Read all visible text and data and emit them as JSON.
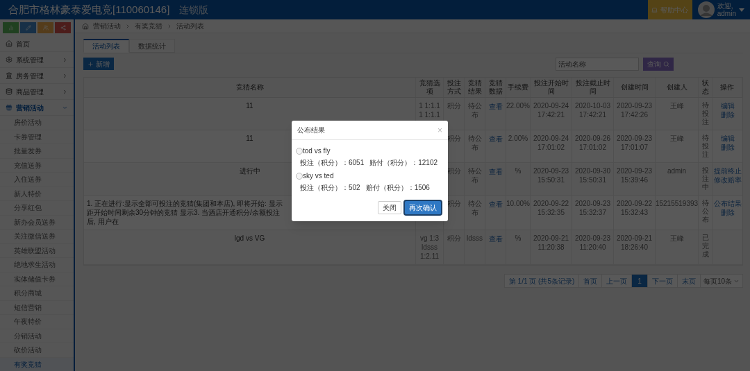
{
  "header": {
    "title": "合肥市格林豪泰爱电竞[110060146]",
    "edition": "连锁版",
    "help": "帮助中心",
    "greeting": "欢迎,",
    "user": "admin"
  },
  "sidebar": {
    "items": [
      {
        "label": "首页",
        "kind": "link"
      },
      {
        "label": "系统管理",
        "kind": "group",
        "expanded": false
      },
      {
        "label": "房务管理",
        "kind": "group",
        "expanded": false
      },
      {
        "label": "商品管理",
        "kind": "group",
        "expanded": false
      },
      {
        "label": "营销活动",
        "kind": "group",
        "expanded": true,
        "children": [
          {
            "label": "房价活动",
            "selected": false
          },
          {
            "label": "卡券管理",
            "selected": false
          },
          {
            "label": "批量发券",
            "selected": false
          },
          {
            "label": "充值送券",
            "selected": false
          },
          {
            "label": "入住送券",
            "selected": false
          },
          {
            "label": "新人特价",
            "selected": false
          },
          {
            "label": "分享红包",
            "selected": false
          },
          {
            "label": "新办会员送券",
            "selected": false
          },
          {
            "label": "关注微信送券",
            "selected": false
          },
          {
            "label": "英雄联盟活动",
            "selected": false
          },
          {
            "label": "绝地求生活动",
            "selected": false
          },
          {
            "label": "实体储值卡券",
            "selected": false
          },
          {
            "label": "积分商城",
            "selected": false
          },
          {
            "label": "短信营销",
            "selected": false
          },
          {
            "label": "午夜特价",
            "selected": false
          },
          {
            "label": "分销活动",
            "selected": false
          },
          {
            "label": "砍价活动",
            "selected": false
          },
          {
            "label": "有奖竞猜",
            "selected": true
          }
        ]
      }
    ]
  },
  "breadcrumb": [
    "营销活动",
    "有奖竞猜",
    "活动列表"
  ],
  "tabs": [
    {
      "label": "活动列表",
      "selected": true
    },
    {
      "label": "数据统计",
      "selected": false
    }
  ],
  "toolbar": {
    "add": "新增",
    "search": {
      "placeholder": "活动名称"
    },
    "query": "查询"
  },
  "table": {
    "columns": [
      "竞猜名称",
      "竞猜选项",
      "投注方式",
      "竞猜结果",
      "竞猜数据",
      "手续费",
      "投注开始时间",
      "投注截止时间",
      "创建时间",
      "创建人",
      "状态",
      "操作"
    ],
    "rows": [
      {
        "name": "11",
        "options": [
          "1 1:1.1",
          "1 1:1.1"
        ],
        "method": "积分",
        "result": "待公布",
        "data": "查看",
        "fee": "22.00%",
        "start": "2020-09-24 17:42:21",
        "end": "2020-10-03 17:42:21",
        "created": "2020-09-23 17:42:26",
        "creator": "王峰",
        "status": "待投注",
        "actions": [
          "编辑",
          "删除"
        ]
      },
      {
        "name": "11",
        "options": [],
        "method": "积分",
        "result": "待公布",
        "data": "查看",
        "fee": "2.00%",
        "start": "2020-09-24 17:01:02",
        "end": "2020-09-26 17:01:02",
        "created": "2020-09-23 17:01:07",
        "creator": "王峰",
        "status": "待投注",
        "actions": [
          "编辑",
          "删除"
        ]
      },
      {
        "name": "进行中",
        "options": [],
        "method": "积分",
        "result": "待公布",
        "data": "查看",
        "fee": "%",
        "start": "2020-09-23 15:50:31",
        "end": "2020-09-30 15:50:31",
        "created": "2020-09-23 15:39:46",
        "creator": "admin",
        "status": "投注中",
        "actions": [
          "提前终止",
          "修改赔率"
        ]
      },
      {
        "name": "1. 正在进行:显示全部可投注的竞猜(集团和本店), 即将开始: 显示距开始时间剩余30分钟的竞猜 显示3. 当酒店开通积分/余额投注后, 用户在",
        "options": [],
        "method": "积分",
        "result": "待公布",
        "data": "查看",
        "fee": "10.00%",
        "start": "2020-09-22 15:32:35",
        "end": "2020-09-23 15:32:37",
        "created": "2020-09-22 15:32:43",
        "creator": "15215519393",
        "status": "待公布",
        "actions": [
          "公布结果",
          "删除"
        ]
      },
      {
        "name": "lgd vs VG",
        "options": [
          "vg 1:3",
          "ldsss",
          "1:2.11"
        ],
        "method": "积分",
        "result": "ldsss",
        "data": "查看",
        "fee": "%",
        "start": "2020-09-21 11:20:38",
        "end": "2020-09-23 11:20:40",
        "created": "2020-09-21 18:26:40",
        "creator": "王峰",
        "status": "已完成",
        "actions": []
      }
    ]
  },
  "pagination": {
    "info": "第 1/1 页 (共5条记录)",
    "first": "首页",
    "prev": "上一页",
    "pages": [
      {
        "label": "1",
        "selected": true
      }
    ],
    "next": "下一页",
    "last": "末页",
    "page_size": "每页10条"
  },
  "modal": {
    "title": "公布结果",
    "close": "×",
    "options": [
      {
        "label": "tod vs fly",
        "bet": "投注（积分）：6051",
        "payout": "赔付（积分）：12102",
        "selected": false
      },
      {
        "label": "sky vs ted",
        "bet": "投注（积分）：502",
        "payout": "赔付（积分）：1506",
        "selected": false
      }
    ],
    "buttons": [
      {
        "label": "关闭",
        "kind": "secondary"
      },
      {
        "label": "再次确认",
        "kind": "primary"
      }
    ]
  }
}
